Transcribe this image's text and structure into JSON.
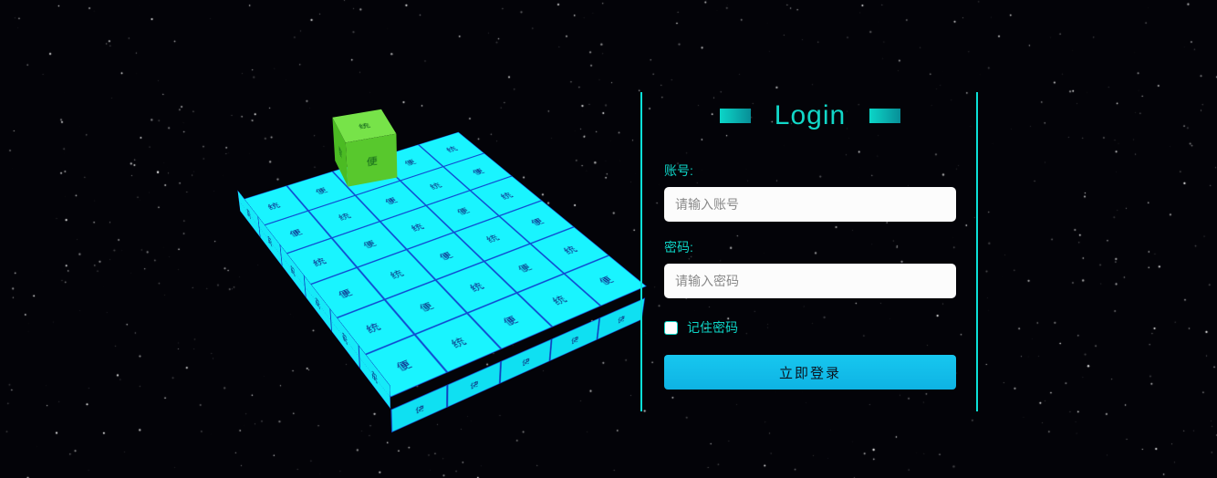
{
  "login": {
    "title": "Login",
    "username_label": "账号:",
    "username_placeholder": "请输入账号",
    "password_label": "密码:",
    "password_placeholder": "请输入密码",
    "remember_label": "记住密码",
    "submit_label": "立即登录"
  },
  "decor": {
    "grid_chars": [
      "统",
      "便"
    ],
    "cube_chars": [
      "统",
      "便",
      "便"
    ],
    "grid_cols": 5,
    "grid_rows": 6
  }
}
